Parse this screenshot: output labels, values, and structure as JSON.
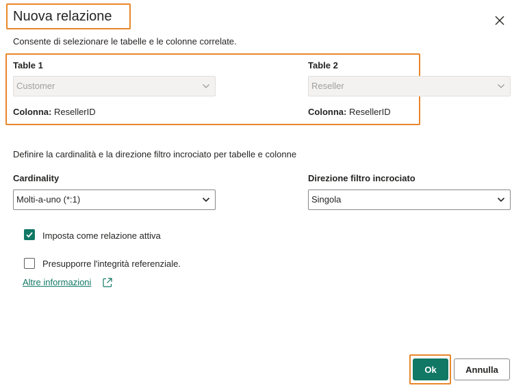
{
  "dialog": {
    "title": "Nuova relazione",
    "subtitle": "Consente di selezionare le tabelle e le colonne correlate."
  },
  "tables": {
    "table1": {
      "label": "Table 1",
      "selected": "Customer",
      "column_label": "Colonna:",
      "column_value": "ResellerID"
    },
    "table2": {
      "label": "Table 2",
      "selected": "Reseller",
      "column_label": "Colonna:",
      "column_value": "ResellerID"
    }
  },
  "settings": {
    "section_text": "Definire la cardinalità e la direzione filtro incrociato per tabelle e colonne",
    "cardinality_label": "Cardinality",
    "cardinality_value": "Molti-a-uno (*:1)",
    "crossfilter_label": "Direzione filtro incrociato",
    "crossfilter_value": "Singola"
  },
  "options": {
    "active": {
      "label": "Imposta come relazione attiva",
      "checked": true
    },
    "integrity": {
      "label": "Presupporre l'integrità referenziale.",
      "checked": false
    }
  },
  "link": {
    "label": "Altre informazioni"
  },
  "buttons": {
    "ok": "Ok",
    "cancel": "Annulla"
  },
  "colors": {
    "accent": "#117865",
    "highlight": "#e8862a"
  }
}
